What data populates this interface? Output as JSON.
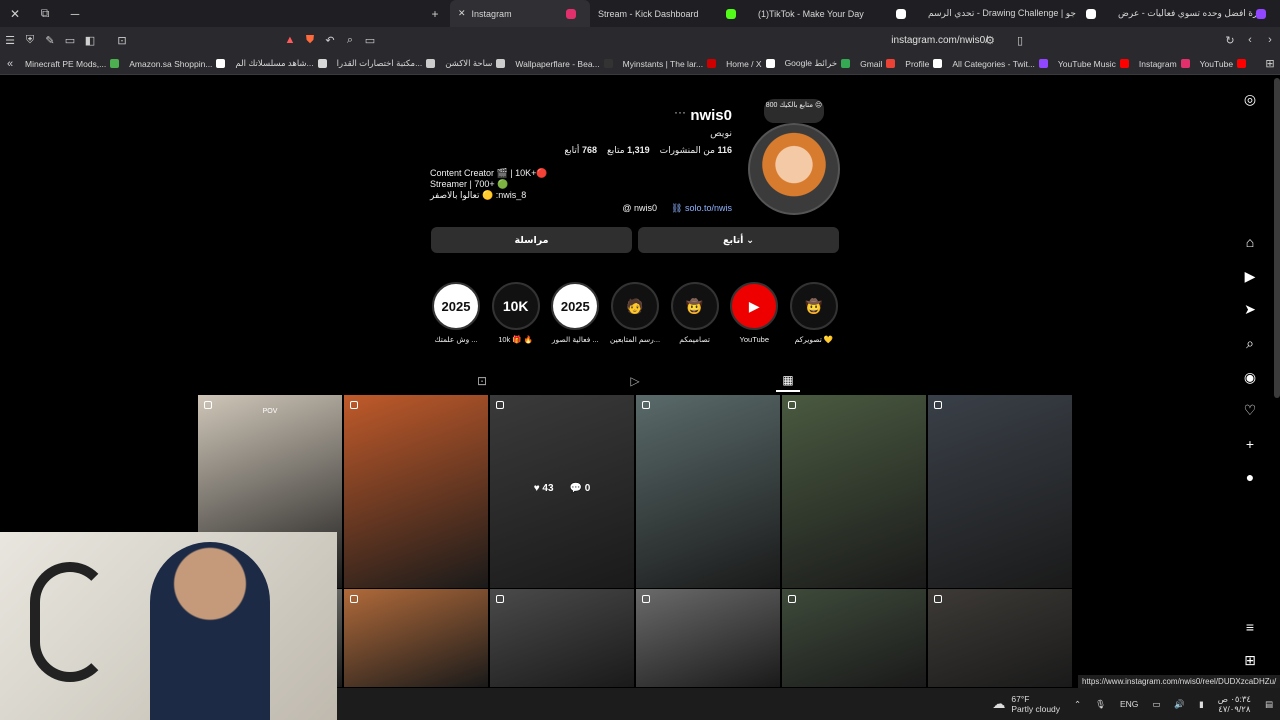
{
  "browser": {
    "tabs": [
      {
        "label": "Instagram",
        "icon_color": "#e1306c",
        "active": true
      },
      {
        "label": "Stream - Kick Dashboard",
        "icon_color": "#53fc18",
        "active": false
      },
      {
        "label": "(1)TikTok - Make Your Day",
        "icon_color": "#ffffff",
        "active": false
      },
      {
        "label": "تحدي الرسم - Drawing Challenge | جو",
        "icon_color": "#ffffff",
        "active": false
      },
      {
        "label": "سارة افضل وحده تسوي فعاليات - عرض",
        "icon_color": "#9146ff",
        "active": false
      }
    ],
    "url": "instagram.com/nwis0/",
    "bookmarks": [
      {
        "label": "Minecraft PE Mods,...",
        "icon_color": "#4caf50"
      },
      {
        "label": "Amazon.sa Shoppin...",
        "icon_color": "#ffffff"
      },
      {
        "label": "شاهد مسلسلاتك الم...",
        "icon_color": "#d7d7d7"
      },
      {
        "label": "مكتبة اختصارات القدرا...",
        "icon_color": "#cccccc"
      },
      {
        "label": "ساحة الاكشن",
        "icon_color": "#cccccc"
      },
      {
        "label": "Wallpaperflare - Bea...",
        "icon_color": "#333333"
      },
      {
        "label": "Myinstants | The lar...",
        "icon_color": "#cc0000"
      },
      {
        "label": "Home / X",
        "icon_color": "#ffffff"
      },
      {
        "label": "Google خرائط",
        "icon_color": "#34a853"
      },
      {
        "label": "Gmail",
        "icon_color": "#ea4335"
      },
      {
        "label": "Profile",
        "icon_color": "#ffffff"
      },
      {
        "label": "All Categories - Twit...",
        "icon_color": "#9146ff"
      },
      {
        "label": "YouTube Music",
        "icon_color": "#ff0000"
      },
      {
        "label": "Instagram",
        "icon_color": "#e1306c"
      },
      {
        "label": "YouTube",
        "icon_color": "#ff0000"
      }
    ]
  },
  "profile": {
    "username": "nwis0",
    "full_name": "نويص",
    "note": "800 متابع بالكيك 😔",
    "stats": {
      "posts": "116",
      "posts_label": "من المنشورات",
      "followers": "1,319",
      "followers_label": "متابع",
      "following": "768",
      "following_label": "أتابع"
    },
    "bio": [
      "Content Creator 🎬 | 10K+🔴",
      "Streamer | 700+ 🟢",
      "تعالوا بالاصفر 🟡 :nwis_8"
    ],
    "threads": "nwis0",
    "link": "solo.to/nwis",
    "buttons": {
      "message": "مراسلة",
      "following": "أتابع"
    }
  },
  "highlights": [
    {
      "label": "تصويركم 💛",
      "art": "🤠"
    },
    {
      "label": "YouTube",
      "art": "▶"
    },
    {
      "label": "تصاميمكم",
      "art": "🤠"
    },
    {
      "label": "رسم المتابعين...",
      "art": "🧑"
    },
    {
      "label": "فعالية الصور ...",
      "art": "2025"
    },
    {
      "label": "10k 🎁 🔥",
      "art": "10K"
    },
    {
      "label": "وش علمتك ...",
      "art": "2025"
    }
  ],
  "grid": [
    {
      "caption": "",
      "bg": "#3a4048"
    },
    {
      "caption": "",
      "bg": "#4a5a40"
    },
    {
      "caption": "",
      "bg": "#5a6a6a"
    },
    {
      "caption": "",
      "bg": "#3a3a3a",
      "overlay_comments": "0",
      "overlay_likes": "43"
    },
    {
      "caption": "",
      "bg": "#c05a2a"
    },
    {
      "caption": "POV",
      "bg": "#cfc6b8"
    },
    {
      "caption": "",
      "bg": "#3d3a36"
    },
    {
      "caption": "",
      "bg": "#3e4a3a"
    },
    {
      "caption": "",
      "bg": "#6a6a6a"
    },
    {
      "caption": "",
      "bg": "#4a4a4a"
    },
    {
      "caption": "",
      "bg": "#b06a3a"
    },
    {
      "caption": "",
      "bg": "#8a8a86"
    }
  ],
  "statusbar": {
    "link": "https://www.instagram.com/nwis0/reel/DUDXzcaDHZu/",
    "weather_temp": "67°F",
    "weather_text": "Partly cloudy",
    "lang": "ENG",
    "time": "٠٥:٣٤ ص",
    "date": "٤٧/٠٩/٢٨"
  },
  "colors": {
    "accent": "#e1306c",
    "link": "#8fb3ff",
    "bg": "#000000"
  }
}
